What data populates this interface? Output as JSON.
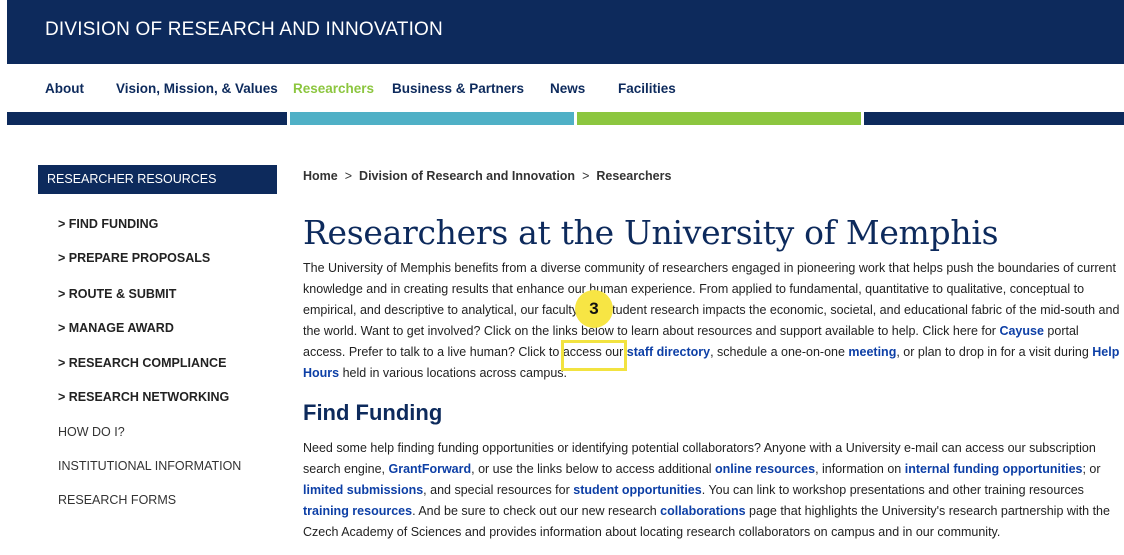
{
  "header": {
    "title": "DIVISION OF RESEARCH AND INNOVATION"
  },
  "nav": {
    "items": [
      {
        "label": "About",
        "active": false
      },
      {
        "label": "Vision, Mission, & Values",
        "active": false
      },
      {
        "label": "Researchers",
        "active": true
      },
      {
        "label": "Business & Partners",
        "active": false
      },
      {
        "label": "News",
        "active": false
      },
      {
        "label": "Facilities",
        "active": false
      }
    ]
  },
  "colors": {
    "navy": "#0d2a5c",
    "accent_green": "#8cc63f",
    "teal": "#4fb0c6",
    "link_blue": "#0d3fa6",
    "highlight_yellow": "#f2e340"
  },
  "sidebar": {
    "header": "RESEARCHER RESOURCES",
    "items": [
      {
        "label": "> FIND FUNDING"
      },
      {
        "label": "> PREPARE PROPOSALS"
      },
      {
        "label": "> ROUTE & SUBMIT"
      },
      {
        "label": "> MANAGE AWARD"
      },
      {
        "label": "> RESEARCH COMPLIANCE"
      },
      {
        "label": "> RESEARCH NETWORKING"
      },
      {
        "label": "HOW DO I?"
      },
      {
        "label": "INSTITUTIONAL INFORMATION"
      },
      {
        "label": "RESEARCH FORMS"
      }
    ]
  },
  "breadcrumb": {
    "home": "Home",
    "sep": ">",
    "level1": "Division of Research and Innovation",
    "level2": "Researchers"
  },
  "main": {
    "title": "Researchers at the University of Memphis",
    "intro": {
      "t1": "The University of Memphis benefits from a diverse community of researchers engaged in pioneering work that helps push the boundaries of current knowledge and in creating results that enhance our human experience. From applied to fundamental, quantitative to qualitative, conceptual to empirical, and descriptive to analytical, our faculty and student research impacts the economic, societal, and educational fabric of the mid-south and the world. Want to get involved? Click on the links below to learn about resources and support available to help.  Click here for ",
      "cayuse": "Cayuse",
      "t2": " portal access.   Prefer to talk to a live human? Click to access our ",
      "staff_directory": "staff directory",
      "t3": ", schedule a one-on-one ",
      "meeting": "meeting",
      "t4": ", or plan to drop in for a visit during ",
      "help_hours": "Help Hours",
      "t5": " held in various locations across campus."
    },
    "find_funding": {
      "heading": "Find Funding",
      "t1": "Need some help finding funding opportunities or identifying potential collaborators? Anyone with a University e-mail can access our subscription search engine, ",
      "grantforward": "GrantForward",
      "t2": ", or use the links below to access additional ",
      "online_resources": "online resources",
      "t3": ", information on ",
      "internal_funding": "internal funding opportunities",
      "t4": "; or ",
      "limited_submissions": "limited submissions",
      "t5": ", and special resources for ",
      "student_opportunities": "student opportunities",
      "t6": ". You can link to workshop presentations and other training resources ",
      "training_resources": "training resources",
      "t7": ". And be sure to check out our new research ",
      "collaborations": "collaborations",
      "t8": " page that highlights the University's research partnership with the Czech Academy of Sciences and provides information about locating research collaborators on campus and in our community."
    }
  },
  "annotation": {
    "step": "3"
  }
}
